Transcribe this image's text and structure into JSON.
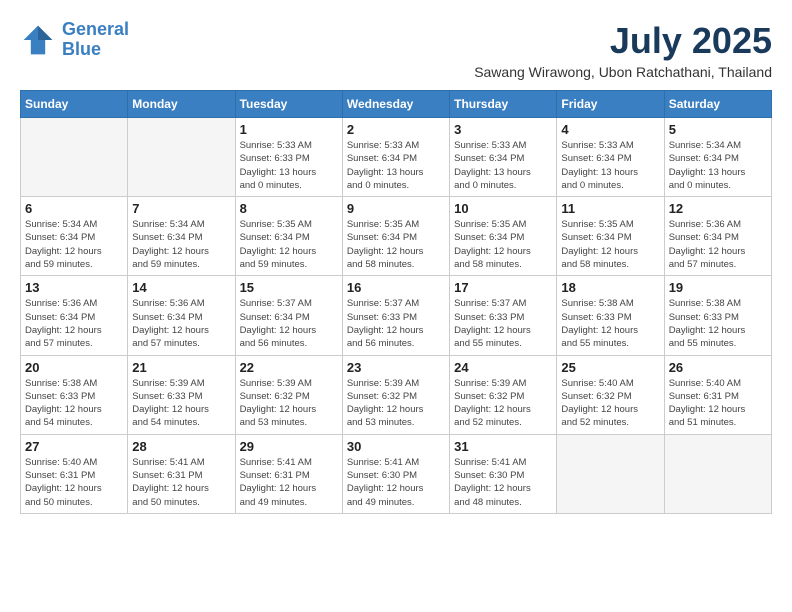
{
  "header": {
    "logo_line1": "General",
    "logo_line2": "Blue",
    "month": "July 2025",
    "location": "Sawang Wirawong, Ubon Ratchathani, Thailand"
  },
  "days_of_week": [
    "Sunday",
    "Monday",
    "Tuesday",
    "Wednesday",
    "Thursday",
    "Friday",
    "Saturday"
  ],
  "weeks": [
    [
      {
        "day": "",
        "info": ""
      },
      {
        "day": "",
        "info": ""
      },
      {
        "day": "1",
        "info": "Sunrise: 5:33 AM\nSunset: 6:33 PM\nDaylight: 13 hours\nand 0 minutes."
      },
      {
        "day": "2",
        "info": "Sunrise: 5:33 AM\nSunset: 6:34 PM\nDaylight: 13 hours\nand 0 minutes."
      },
      {
        "day": "3",
        "info": "Sunrise: 5:33 AM\nSunset: 6:34 PM\nDaylight: 13 hours\nand 0 minutes."
      },
      {
        "day": "4",
        "info": "Sunrise: 5:33 AM\nSunset: 6:34 PM\nDaylight: 13 hours\nand 0 minutes."
      },
      {
        "day": "5",
        "info": "Sunrise: 5:34 AM\nSunset: 6:34 PM\nDaylight: 13 hours\nand 0 minutes."
      }
    ],
    [
      {
        "day": "6",
        "info": "Sunrise: 5:34 AM\nSunset: 6:34 PM\nDaylight: 12 hours\nand 59 minutes."
      },
      {
        "day": "7",
        "info": "Sunrise: 5:34 AM\nSunset: 6:34 PM\nDaylight: 12 hours\nand 59 minutes."
      },
      {
        "day": "8",
        "info": "Sunrise: 5:35 AM\nSunset: 6:34 PM\nDaylight: 12 hours\nand 59 minutes."
      },
      {
        "day": "9",
        "info": "Sunrise: 5:35 AM\nSunset: 6:34 PM\nDaylight: 12 hours\nand 58 minutes."
      },
      {
        "day": "10",
        "info": "Sunrise: 5:35 AM\nSunset: 6:34 PM\nDaylight: 12 hours\nand 58 minutes."
      },
      {
        "day": "11",
        "info": "Sunrise: 5:35 AM\nSunset: 6:34 PM\nDaylight: 12 hours\nand 58 minutes."
      },
      {
        "day": "12",
        "info": "Sunrise: 5:36 AM\nSunset: 6:34 PM\nDaylight: 12 hours\nand 57 minutes."
      }
    ],
    [
      {
        "day": "13",
        "info": "Sunrise: 5:36 AM\nSunset: 6:34 PM\nDaylight: 12 hours\nand 57 minutes."
      },
      {
        "day": "14",
        "info": "Sunrise: 5:36 AM\nSunset: 6:34 PM\nDaylight: 12 hours\nand 57 minutes."
      },
      {
        "day": "15",
        "info": "Sunrise: 5:37 AM\nSunset: 6:34 PM\nDaylight: 12 hours\nand 56 minutes."
      },
      {
        "day": "16",
        "info": "Sunrise: 5:37 AM\nSunset: 6:33 PM\nDaylight: 12 hours\nand 56 minutes."
      },
      {
        "day": "17",
        "info": "Sunrise: 5:37 AM\nSunset: 6:33 PM\nDaylight: 12 hours\nand 55 minutes."
      },
      {
        "day": "18",
        "info": "Sunrise: 5:38 AM\nSunset: 6:33 PM\nDaylight: 12 hours\nand 55 minutes."
      },
      {
        "day": "19",
        "info": "Sunrise: 5:38 AM\nSunset: 6:33 PM\nDaylight: 12 hours\nand 55 minutes."
      }
    ],
    [
      {
        "day": "20",
        "info": "Sunrise: 5:38 AM\nSunset: 6:33 PM\nDaylight: 12 hours\nand 54 minutes."
      },
      {
        "day": "21",
        "info": "Sunrise: 5:39 AM\nSunset: 6:33 PM\nDaylight: 12 hours\nand 54 minutes."
      },
      {
        "day": "22",
        "info": "Sunrise: 5:39 AM\nSunset: 6:32 PM\nDaylight: 12 hours\nand 53 minutes."
      },
      {
        "day": "23",
        "info": "Sunrise: 5:39 AM\nSunset: 6:32 PM\nDaylight: 12 hours\nand 53 minutes."
      },
      {
        "day": "24",
        "info": "Sunrise: 5:39 AM\nSunset: 6:32 PM\nDaylight: 12 hours\nand 52 minutes."
      },
      {
        "day": "25",
        "info": "Sunrise: 5:40 AM\nSunset: 6:32 PM\nDaylight: 12 hours\nand 52 minutes."
      },
      {
        "day": "26",
        "info": "Sunrise: 5:40 AM\nSunset: 6:31 PM\nDaylight: 12 hours\nand 51 minutes."
      }
    ],
    [
      {
        "day": "27",
        "info": "Sunrise: 5:40 AM\nSunset: 6:31 PM\nDaylight: 12 hours\nand 50 minutes."
      },
      {
        "day": "28",
        "info": "Sunrise: 5:41 AM\nSunset: 6:31 PM\nDaylight: 12 hours\nand 50 minutes."
      },
      {
        "day": "29",
        "info": "Sunrise: 5:41 AM\nSunset: 6:31 PM\nDaylight: 12 hours\nand 49 minutes."
      },
      {
        "day": "30",
        "info": "Sunrise: 5:41 AM\nSunset: 6:30 PM\nDaylight: 12 hours\nand 49 minutes."
      },
      {
        "day": "31",
        "info": "Sunrise: 5:41 AM\nSunset: 6:30 PM\nDaylight: 12 hours\nand 48 minutes."
      },
      {
        "day": "",
        "info": ""
      },
      {
        "day": "",
        "info": ""
      }
    ]
  ]
}
